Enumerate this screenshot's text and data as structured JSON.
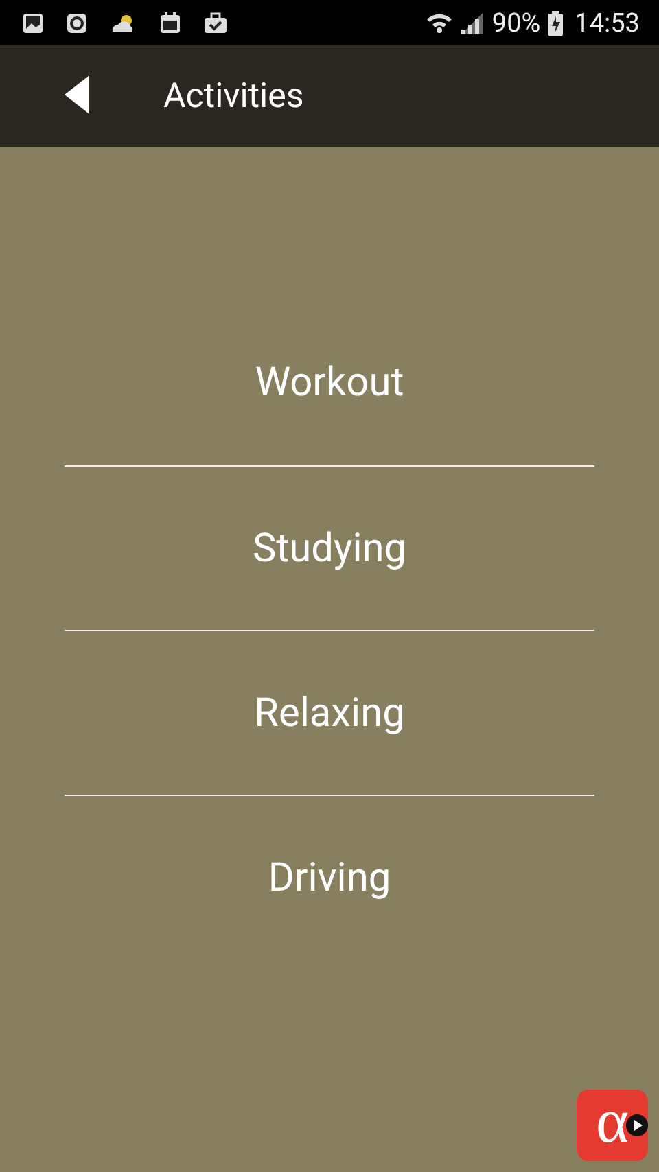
{
  "status_bar": {
    "battery": "90%",
    "time": "14:53"
  },
  "header": {
    "title": "Activities"
  },
  "activities": [
    {
      "label": "Workout"
    },
    {
      "label": "Studying"
    },
    {
      "label": "Relaxing"
    },
    {
      "label": "Driving"
    }
  ],
  "corner_badge": {
    "logo": "α"
  }
}
